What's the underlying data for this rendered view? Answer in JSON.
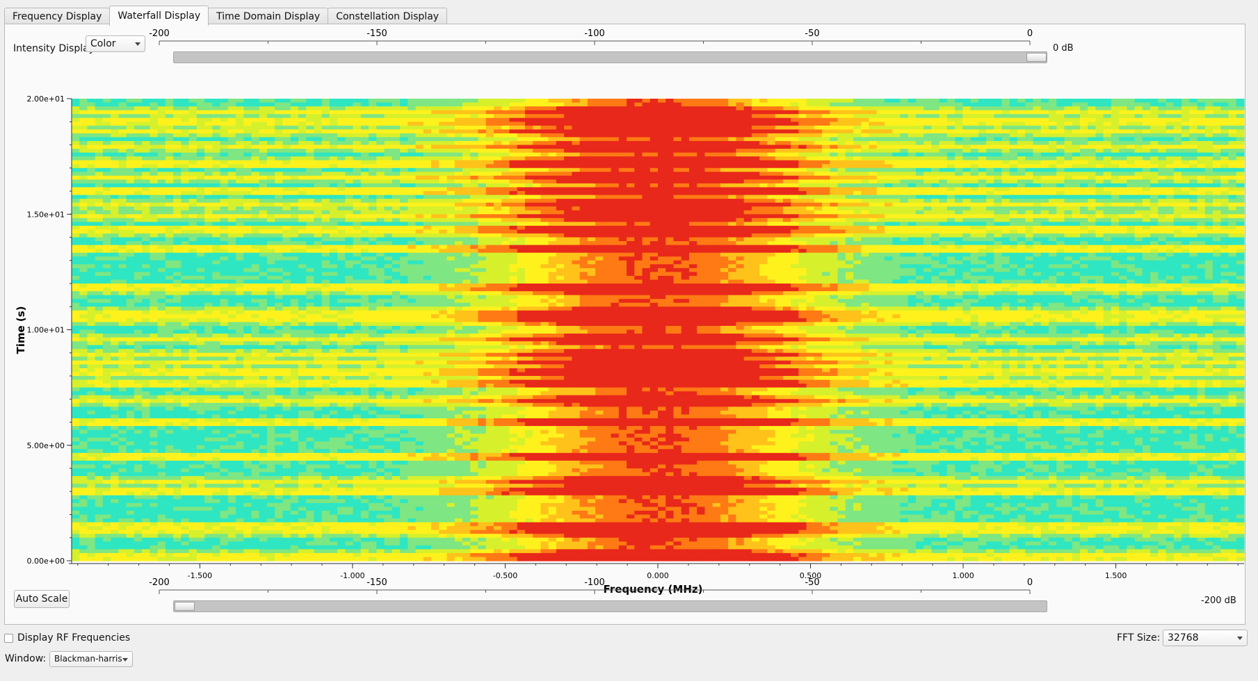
{
  "tabs": [
    {
      "label": "Frequency Display",
      "active": false
    },
    {
      "label": "Waterfall Display",
      "active": true
    },
    {
      "label": "Time Domain Display",
      "active": false
    },
    {
      "label": "Constellation Display",
      "active": false
    }
  ],
  "intensity": {
    "label": "Intensity Display:",
    "value": "Color"
  },
  "top_scale": {
    "ticks": [
      "-200",
      "-150",
      "-100",
      "-50",
      "0"
    ],
    "value_label": "0 dB",
    "value_db": 0
  },
  "bottom_scale": {
    "ticks": [
      "-200",
      "-150",
      "-100",
      "-50",
      "0"
    ],
    "value_label": "-200 dB",
    "value_db": -200
  },
  "auto_scale_label": "Auto Scale",
  "display_rf": {
    "label": "Display RF Frequencies",
    "checked": false
  },
  "fft": {
    "label": "FFT Size:",
    "value": "32768"
  },
  "window": {
    "label": "Window:",
    "value": "Blackman-harris"
  },
  "chart_data": {
    "type": "heatmap",
    "xlabel": "Frequency (MHz)",
    "ylabel": "Time (s)",
    "x_ticks": [
      "-1.500",
      "-1.000",
      "-0.500",
      "0.000",
      "0.500",
      "1.000",
      "1.500"
    ],
    "x_tick_values": [
      -1.5,
      -1.0,
      -0.5,
      0.0,
      0.5,
      1.0,
      1.5
    ],
    "y_ticks": [
      "0.00e+00",
      "5.00e+00",
      "1.00e+01",
      "1.50e+01",
      "2.00e+01"
    ],
    "y_tick_values": [
      0,
      5,
      10,
      15,
      20
    ],
    "xlim": [
      -1.92,
      1.92
    ],
    "ylim": [
      0,
      20
    ],
    "colormap": [
      "#2ee6c2",
      "#7ee682",
      "#d6f02c",
      "#fff21c",
      "#ffc21a",
      "#ff7a14",
      "#e8281a"
    ],
    "intensity_range_db": [
      -200,
      0
    ],
    "signal_center_mhz": 0.0,
    "signal_half_width_mhz": 0.35,
    "strong_rows_s": [
      19.4,
      19.0,
      18.6,
      17.9,
      17.2,
      16.6,
      16.0,
      15.4,
      14.9,
      14.3,
      13.5,
      11.8,
      10.7,
      10.4,
      9.6,
      8.9,
      8.6,
      8.2,
      7.7,
      6.9,
      6.0,
      4.5,
      3.4,
      3.0,
      1.5,
      1.3,
      0.2
    ]
  }
}
